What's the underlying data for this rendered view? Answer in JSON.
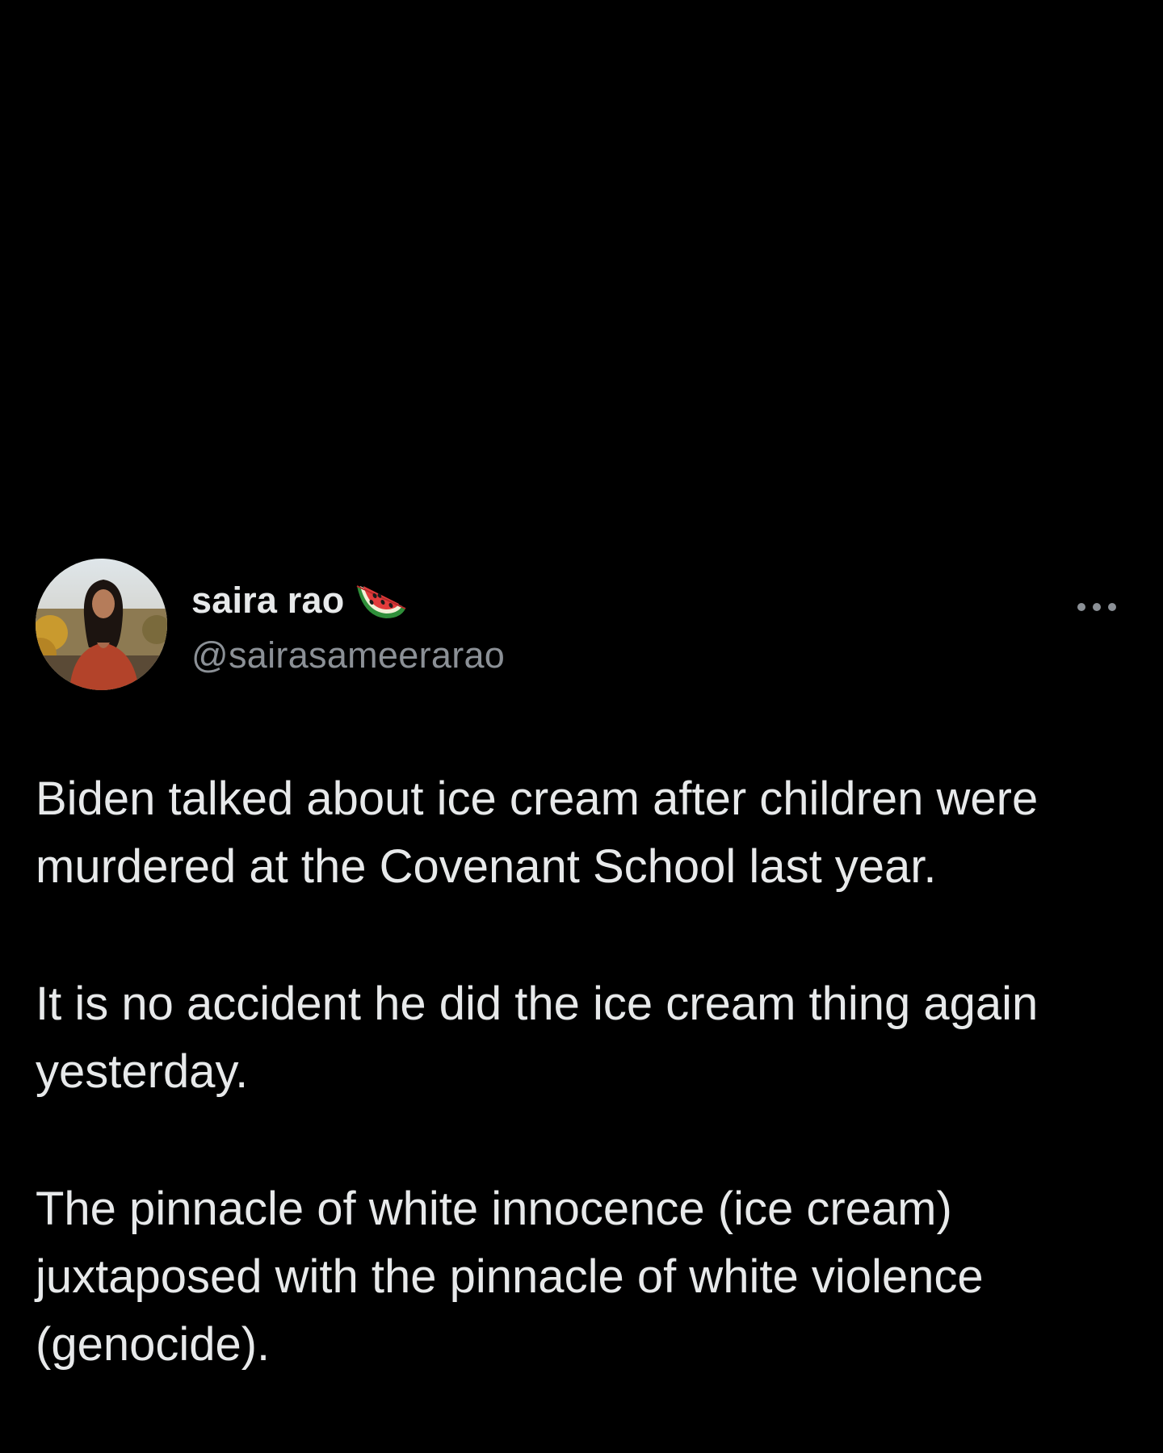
{
  "post": {
    "author": {
      "display_name": "saira rao",
      "handle": "@sairasameerarao",
      "name_emoji": "watermelon-icon",
      "avatar": "avatar-photo"
    },
    "more_icon": "more-horizontal-icon",
    "body": {
      "paragraphs": [
        "Biden talked about ice cream after children were\nmurdered at the Covenant School last year.",
        "It is no accident he did the ice cream thing again\nyesterday.",
        "The pinnacle of white innocence (ice cream)\njuxtaposed with the pinnacle of white violence\n(genocide)."
      ]
    }
  },
  "colors": {
    "background": "#000000",
    "text_primary": "#e7e9ea",
    "text_secondary": "#8b9096"
  }
}
